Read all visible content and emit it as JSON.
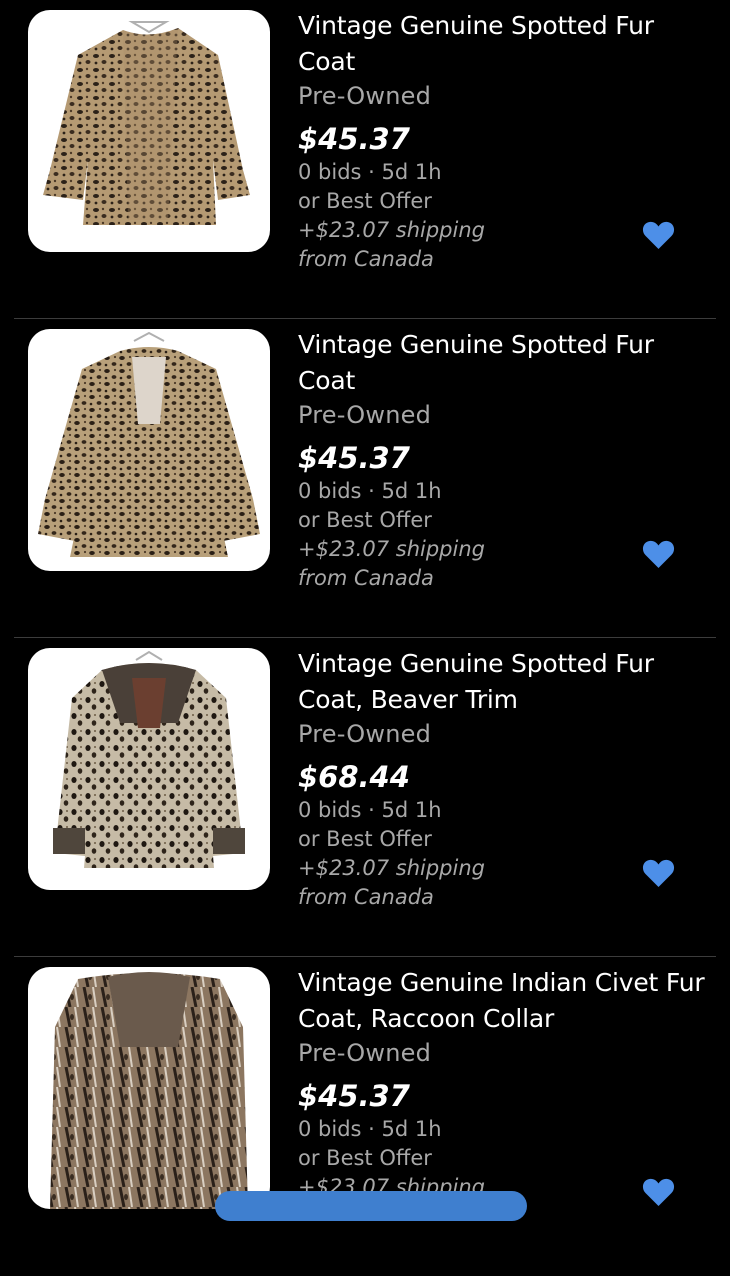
{
  "listings": [
    {
      "title": "Vintage Genuine Spotted Fur Coat",
      "condition": "Pre-Owned",
      "price": "$45.37",
      "bids": "0 bids · 5d 1h",
      "offer": "or Best Offer",
      "shipping": "+$23.07 shipping",
      "origin": "from Canada",
      "image": "spotted-fur-coat-photo",
      "watch_icon": "heart-icon"
    },
    {
      "title": "Vintage Genuine Spotted Fur Coat",
      "condition": "Pre-Owned",
      "price": "$45.37",
      "bids": "0 bids · 5d 1h",
      "offer": "or Best Offer",
      "shipping": "+$23.07 shipping",
      "origin": "from Canada",
      "image": "spotted-fur-coat-photo",
      "watch_icon": "heart-icon"
    },
    {
      "title": "Vintage Genuine Spotted Fur Coat, Beaver Trim",
      "condition": "Pre-Owned",
      "price": "$68.44",
      "bids": "0 bids · 5d 1h",
      "offer": "or Best Offer",
      "shipping": "+$23.07 shipping",
      "origin": "from Canada",
      "image": "spotted-fur-coat-beaver-trim-photo",
      "watch_icon": "heart-icon"
    },
    {
      "title": "Vintage Genuine Indian Civet Fur Coat, Raccoon Collar",
      "condition": "Pre-Owned",
      "price": "$45.37",
      "bids": "0 bids · 5d 1h",
      "offer": "or Best Offer",
      "shipping": "+$23.07 shipping",
      "origin": "",
      "image": "civet-fur-coat-photo",
      "watch_icon": "heart-icon"
    }
  ],
  "colors": {
    "background": "#000000",
    "text_primary": "#ffffff",
    "text_secondary": "#a8a8a8",
    "heart": "#4d8fe8",
    "divider": "#3c3c3c"
  }
}
